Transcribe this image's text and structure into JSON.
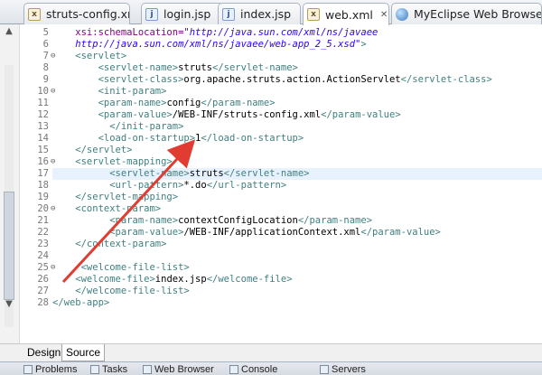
{
  "tabs": [
    {
      "label": "struts-config.xml",
      "icon": "xml-file-icon"
    },
    {
      "label": "login.jsp",
      "icon": "jsp-file-icon"
    },
    {
      "label": "index.jsp",
      "icon": "jsp-file-icon"
    },
    {
      "label": "web.xml",
      "icon": "xml-file-icon",
      "active": true
    },
    {
      "label": "MyEclipse Web Browse",
      "icon": "globe-icon"
    }
  ],
  "tab_close_glyph": "✕",
  "editor": {
    "line_numbers": [
      "5",
      "6",
      "7",
      "8",
      "9",
      "10",
      "11",
      "12",
      "13",
      "14",
      "15",
      "16",
      "17",
      "18",
      "19",
      "20",
      "21",
      "22",
      "23",
      "24",
      "25",
      "26",
      "27",
      "28"
    ],
    "highlighted_line": "17",
    "lines": [
      [
        {
          "t": "    xsi:schemaLocation=",
          "c": "attr"
        },
        {
          "t": "\"http://java.sun.com/xml/ns/javaee",
          "c": "val"
        }
      ],
      [
        {
          "t": "    http://java.sun.com/xml/ns/javaee/web-app_2_5.xsd\"",
          "c": "val"
        },
        {
          "t": ">",
          "c": "tag"
        }
      ],
      [
        {
          "t": "    <servlet>",
          "c": "tag"
        }
      ],
      [
        {
          "t": "        <servlet-name>",
          "c": "tag"
        },
        {
          "t": "struts",
          "c": "txt"
        },
        {
          "t": "</servlet-name>",
          "c": "tag"
        }
      ],
      [
        {
          "t": "        <servlet-class>",
          "c": "tag"
        },
        {
          "t": "org.apache.struts.action.ActionServlet",
          "c": "txt"
        },
        {
          "t": "</servlet-class>",
          "c": "tag"
        }
      ],
      [
        {
          "t": "        <init-param>",
          "c": "tag"
        }
      ],
      [
        {
          "t": "        <param-name>",
          "c": "tag"
        },
        {
          "t": "config",
          "c": "txt"
        },
        {
          "t": "</param-name>",
          "c": "tag"
        }
      ],
      [
        {
          "t": "        <param-value>",
          "c": "tag"
        },
        {
          "t": "/WEB-INF/struts-config.xml",
          "c": "txt"
        },
        {
          "t": "</param-value>",
          "c": "tag"
        }
      ],
      [
        {
          "t": "          </init-param>",
          "c": "tag"
        }
      ],
      [
        {
          "t": "        <load-on-startup>",
          "c": "tag"
        },
        {
          "t": "1",
          "c": "txt"
        },
        {
          "t": "</load-on-startup>",
          "c": "tag"
        }
      ],
      [
        {
          "t": "    </servlet>",
          "c": "tag"
        }
      ],
      [
        {
          "t": "    <servlet-mapping>",
          "c": "tag"
        }
      ],
      [
        {
          "t": "          <servlet-name>",
          "c": "tag"
        },
        {
          "t": "struts",
          "c": "txt"
        },
        {
          "t": "</servlet-name>",
          "c": "tag"
        }
      ],
      [
        {
          "t": "          <url-pattern>",
          "c": "tag"
        },
        {
          "t": "*.do",
          "c": "txt"
        },
        {
          "t": "</url-pattern>",
          "c": "tag"
        }
      ],
      [
        {
          "t": "    </servlet-mapping>",
          "c": "tag"
        }
      ],
      [
        {
          "t": "    <context-param>",
          "c": "tag"
        }
      ],
      [
        {
          "t": "          <param-name>",
          "c": "tag"
        },
        {
          "t": "contextConfigLocation",
          "c": "txt"
        },
        {
          "t": "</param-name>",
          "c": "tag"
        }
      ],
      [
        {
          "t": "          <param-value>",
          "c": "tag"
        },
        {
          "t": "/WEB-INF/applicationContext.xml",
          "c": "txt"
        },
        {
          "t": "</param-value>",
          "c": "tag"
        }
      ],
      [
        {
          "t": "    </context-param>",
          "c": "tag"
        }
      ],
      [
        {
          "t": "",
          "c": "txt"
        }
      ],
      [
        {
          "t": "     <welcome-file-list>",
          "c": "tag"
        }
      ],
      [
        {
          "t": "    <welcome-file>",
          "c": "tag"
        },
        {
          "t": "index.jsp",
          "c": "txt"
        },
        {
          "t": "</welcome-file>",
          "c": "tag"
        }
      ],
      [
        {
          "t": "    </welcome-file-list>",
          "c": "tag"
        }
      ],
      [
        {
          "t": "</web-app>",
          "c": "tag"
        }
      ]
    ],
    "fold_markers": {
      "7": "⊖",
      "10": "⊖",
      "16": "⊖",
      "20": "⊖",
      "25": "⊖"
    }
  },
  "mode_tabs": [
    {
      "label": "Design"
    },
    {
      "label": "Source",
      "active": true
    }
  ],
  "bottom_views": [
    {
      "label": "Problems"
    },
    {
      "label": "Tasks"
    },
    {
      "label": "Web Browser"
    },
    {
      "label": "Console"
    },
    {
      "label": "Servers"
    }
  ],
  "annotation_color": "#e03c31"
}
